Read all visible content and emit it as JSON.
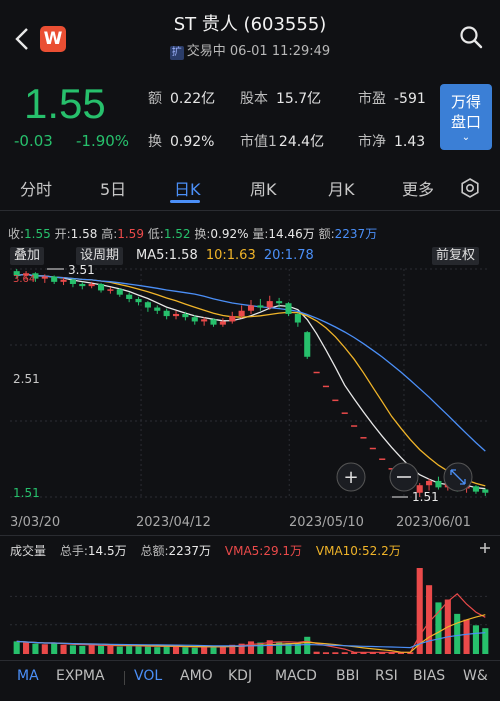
{
  "header": {
    "title": "ST 贵人 (603555)",
    "badge": "扩",
    "status": "交易中 06-01 11:29:49",
    "logo_text": "W"
  },
  "quote": {
    "price": "1.55",
    "change": "-0.03",
    "change_pct": "-1.90%",
    "fields": [
      {
        "key": "额",
        "value": "0.22亿"
      },
      {
        "key": "股本",
        "value": "15.7亿"
      },
      {
        "key": "市盈",
        "value": "-591"
      },
      {
        "key": "换",
        "value": "0.92%"
      },
      {
        "key": "市值1",
        "value": "24.4亿"
      },
      {
        "key": "市净",
        "value": "1.43"
      }
    ],
    "wan_button": "万得\n盘口"
  },
  "tabs": [
    "分时",
    "5日",
    "日K",
    "周K",
    "月K",
    "更多"
  ],
  "active_tab": "日K",
  "stats": {
    "shou_label": "收:",
    "shou": "1.55",
    "kai_label": "开:",
    "kai": "1.58",
    "gao_label": "高:",
    "gao": "1.59",
    "di_label": "低:",
    "di": "1.52",
    "huan_label": "换:",
    "huan": "0.92%",
    "liang_label": "量:",
    "liang": "14.46万",
    "e_label": "额:",
    "e": "2237万"
  },
  "controls": {
    "overlay": "叠加",
    "set_period": "设周期",
    "ma5_label": "MA5:",
    "ma5": "1.58",
    "ma10_label": "10:",
    "ma10": "1.63",
    "ma20_label": "20:",
    "ma20": "1.78",
    "adjust": "前复权"
  },
  "price_axis": {
    "top": "3.51",
    "mid": "2.51",
    "bottom": "1.51",
    "top_left": "3.64"
  },
  "markers": {
    "high": "3.51",
    "low": "1.51"
  },
  "dates": [
    "3/03/20",
    "2023/04/12",
    "2023/05/10",
    "2023/06/01"
  ],
  "volume": {
    "title": "成交量",
    "total_hands_label": "总手:",
    "total_hands": "14.5万",
    "total_amount_label": "总额:",
    "total_amount": "2237万",
    "vma5_label": "VMA5:",
    "vma5": "29.1万",
    "vma10_label": "VMA10:",
    "vma10": "52.2万"
  },
  "indicators": [
    "MA",
    "EXPMA",
    "VOL",
    "AMO",
    "KDJ",
    "MACD",
    "BBI",
    "RSI",
    "BIAS",
    "W&"
  ],
  "active_indicators": [
    "MA",
    "VOL"
  ],
  "colors": {
    "up": "#ea4a4a",
    "down": "#27c06c",
    "accent": "#4b8ff7",
    "ma5": "#e8e8e8",
    "ma10": "#f0b429",
    "ma20": "#4b8ff7"
  },
  "chart_data": {
    "type": "candlestick",
    "ylim": [
      1.51,
      3.64
    ],
    "candles": [
      {
        "o": 3.62,
        "c": 3.58,
        "h": 3.64,
        "l": 3.55
      },
      {
        "o": 3.58,
        "c": 3.6,
        "h": 3.62,
        "l": 3.54
      },
      {
        "o": 3.6,
        "c": 3.55,
        "h": 3.61,
        "l": 3.52
      },
      {
        "o": 3.55,
        "c": 3.57,
        "h": 3.59,
        "l": 3.51
      },
      {
        "o": 3.57,
        "c": 3.52,
        "h": 3.58,
        "l": 3.5
      },
      {
        "o": 3.52,
        "c": 3.54,
        "h": 3.56,
        "l": 3.49
      },
      {
        "o": 3.54,
        "c": 3.5,
        "h": 3.55,
        "l": 3.47
      },
      {
        "o": 3.5,
        "c": 3.48,
        "h": 3.52,
        "l": 3.45
      },
      {
        "o": 3.48,
        "c": 3.5,
        "h": 3.52,
        "l": 3.46
      },
      {
        "o": 3.5,
        "c": 3.44,
        "h": 3.51,
        "l": 3.42
      },
      {
        "o": 3.44,
        "c": 3.45,
        "h": 3.47,
        "l": 3.41
      },
      {
        "o": 3.45,
        "c": 3.4,
        "h": 3.46,
        "l": 3.38
      },
      {
        "o": 3.4,
        "c": 3.36,
        "h": 3.42,
        "l": 3.33
      },
      {
        "o": 3.36,
        "c": 3.33,
        "h": 3.38,
        "l": 3.3
      },
      {
        "o": 3.33,
        "c": 3.28,
        "h": 3.34,
        "l": 3.24
      },
      {
        "o": 3.28,
        "c": 3.25,
        "h": 3.3,
        "l": 3.22
      },
      {
        "o": 3.25,
        "c": 3.2,
        "h": 3.27,
        "l": 3.17
      },
      {
        "o": 3.2,
        "c": 3.22,
        "h": 3.25,
        "l": 3.17
      },
      {
        "o": 3.22,
        "c": 3.19,
        "h": 3.24,
        "l": 3.16
      },
      {
        "o": 3.19,
        "c": 3.15,
        "h": 3.21,
        "l": 3.12
      },
      {
        "o": 3.15,
        "c": 3.17,
        "h": 3.19,
        "l": 3.11
      },
      {
        "o": 3.17,
        "c": 3.12,
        "h": 3.18,
        "l": 3.1
      },
      {
        "o": 3.12,
        "c": 3.15,
        "h": 3.18,
        "l": 3.1
      },
      {
        "o": 3.15,
        "c": 3.2,
        "h": 3.24,
        "l": 3.13
      },
      {
        "o": 3.2,
        "c": 3.25,
        "h": 3.3,
        "l": 3.18
      },
      {
        "o": 3.25,
        "c": 3.3,
        "h": 3.35,
        "l": 3.22
      },
      {
        "o": 3.3,
        "c": 3.28,
        "h": 3.36,
        "l": 3.25
      },
      {
        "o": 3.28,
        "c": 3.34,
        "h": 3.39,
        "l": 3.26
      },
      {
        "o": 3.34,
        "c": 3.32,
        "h": 3.37,
        "l": 3.28
      },
      {
        "o": 3.32,
        "c": 3.22,
        "h": 3.33,
        "l": 3.2
      },
      {
        "o": 3.22,
        "c": 3.14,
        "h": 3.23,
        "l": 3.1
      },
      {
        "o": 3.05,
        "c": 2.82,
        "h": 3.06,
        "l": 2.8
      },
      {
        "o": 2.68,
        "c": 2.68,
        "h": 2.68,
        "l": 2.68
      },
      {
        "o": 2.55,
        "c": 2.55,
        "h": 2.55,
        "l": 2.55
      },
      {
        "o": 2.42,
        "c": 2.42,
        "h": 2.42,
        "l": 2.42
      },
      {
        "o": 2.3,
        "c": 2.3,
        "h": 2.3,
        "l": 2.3
      },
      {
        "o": 2.18,
        "c": 2.18,
        "h": 2.18,
        "l": 2.18
      },
      {
        "o": 2.07,
        "c": 2.07,
        "h": 2.07,
        "l": 2.07
      },
      {
        "o": 1.97,
        "c": 1.97,
        "h": 1.97,
        "l": 1.97
      },
      {
        "o": 1.87,
        "c": 1.87,
        "h": 1.87,
        "l": 1.87
      },
      {
        "o": 1.78,
        "c": 1.78,
        "h": 1.78,
        "l": 1.78
      },
      {
        "o": 1.7,
        "c": 1.7,
        "h": 1.7,
        "l": 1.7
      },
      {
        "o": 1.62,
        "c": 1.62,
        "h": 1.62,
        "l": 1.62
      },
      {
        "o": 1.55,
        "c": 1.62,
        "h": 1.64,
        "l": 1.51
      },
      {
        "o": 1.62,
        "c": 1.66,
        "h": 1.68,
        "l": 1.57
      },
      {
        "o": 1.66,
        "c": 1.6,
        "h": 1.7,
        "l": 1.58
      },
      {
        "o": 1.6,
        "c": 1.63,
        "h": 1.66,
        "l": 1.57
      },
      {
        "o": 1.63,
        "c": 1.59,
        "h": 1.65,
        "l": 1.56
      },
      {
        "o": 1.59,
        "c": 1.61,
        "h": 1.64,
        "l": 1.55
      },
      {
        "o": 1.61,
        "c": 1.56,
        "h": 1.62,
        "l": 1.54
      },
      {
        "o": 1.58,
        "c": 1.55,
        "h": 1.59,
        "l": 1.52
      }
    ],
    "volume": [
      22,
      20,
      18,
      17,
      19,
      16,
      15,
      14,
      16,
      15,
      14,
      13,
      15,
      14,
      13,
      12,
      13,
      14,
      12,
      11,
      12,
      13,
      14,
      16,
      18,
      22,
      20,
      24,
      21,
      19,
      18,
      30,
      4,
      3,
      3,
      3,
      3,
      3,
      3,
      3,
      3,
      3,
      3,
      150,
      120,
      90,
      95,
      70,
      60,
      50,
      45
    ],
    "ma": {
      "ma5": "1.58",
      "ma10": "1.63",
      "ma20": "1.78"
    }
  }
}
